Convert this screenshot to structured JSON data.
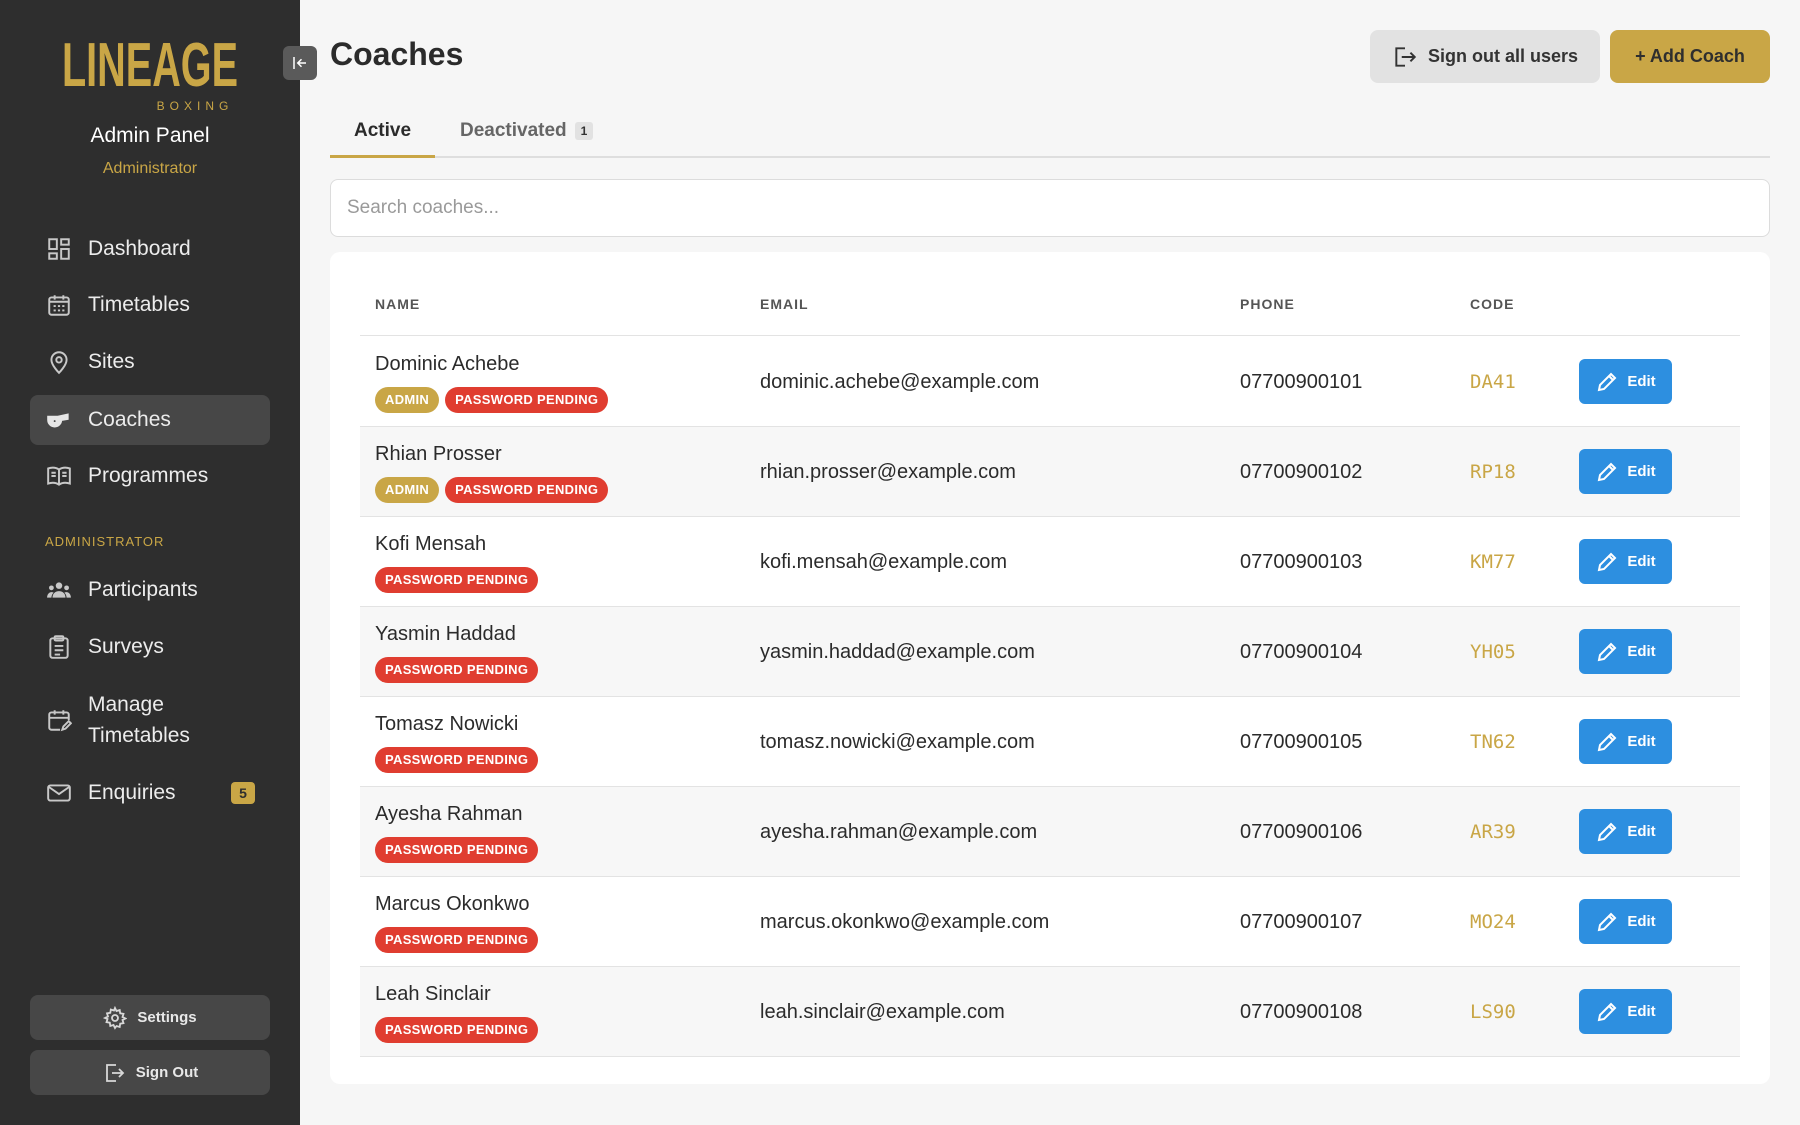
{
  "sidebar": {
    "logo_text": "LINEAGE",
    "logo_subtext": "BOXING",
    "title": "Admin Panel",
    "role": "Administrator",
    "nav": [
      {
        "label": "Dashboard",
        "icon": "dashboard-icon"
      },
      {
        "label": "Timetables",
        "icon": "calendar-icon"
      },
      {
        "label": "Sites",
        "icon": "map-pin-icon"
      },
      {
        "label": "Coaches",
        "icon": "whistle-icon",
        "active": true
      },
      {
        "label": "Programmes",
        "icon": "book-icon"
      }
    ],
    "section_label": "ADMINISTRATOR",
    "admin_nav": [
      {
        "label": "Participants",
        "icon": "people-icon"
      },
      {
        "label": "Surveys",
        "icon": "clipboard-icon"
      },
      {
        "label": "Manage Timetables",
        "icon": "calendar-edit-icon"
      },
      {
        "label": "Enquiries",
        "icon": "mail-icon",
        "badge": "5"
      }
    ],
    "settings_label": "Settings",
    "signout_label": "Sign Out"
  },
  "header": {
    "title": "Coaches",
    "signout_all_label": "Sign out all users",
    "add_label": "+ Add Coach"
  },
  "tabs": {
    "active_label": "Active",
    "deactivated_label": "Deactivated",
    "deactivated_count": "1"
  },
  "search": {
    "placeholder": "Search coaches...",
    "value": ""
  },
  "table": {
    "headers": {
      "name": "NAME",
      "email": "EMAIL",
      "phone": "PHONE",
      "code": "CODE"
    },
    "edit_label": "Edit",
    "rows": [
      {
        "name": "Dominic Achebe",
        "badges": [
          "ADMIN",
          "PASSWORD PENDING"
        ],
        "email": "dominic.achebe@example.com",
        "phone": "07700900101",
        "code": "DA41"
      },
      {
        "name": "Rhian Prosser",
        "badges": [
          "ADMIN",
          "PASSWORD PENDING"
        ],
        "email": "rhian.prosser@example.com",
        "phone": "07700900102",
        "code": "RP18"
      },
      {
        "name": "Kofi Mensah",
        "badges": [
          "PASSWORD PENDING"
        ],
        "email": "kofi.mensah@example.com",
        "phone": "07700900103",
        "code": "KM77"
      },
      {
        "name": "Yasmin Haddad",
        "badges": [
          "PASSWORD PENDING"
        ],
        "email": "yasmin.haddad@example.com",
        "phone": "07700900104",
        "code": "YH05"
      },
      {
        "name": "Tomasz Nowicki",
        "badges": [
          "PASSWORD PENDING"
        ],
        "email": "tomasz.nowicki@example.com",
        "phone": "07700900105",
        "code": "TN62"
      },
      {
        "name": "Ayesha Rahman",
        "badges": [
          "PASSWORD PENDING"
        ],
        "email": "ayesha.rahman@example.com",
        "phone": "07700900106",
        "code": "AR39"
      },
      {
        "name": "Marcus Okonkwo",
        "badges": [
          "PASSWORD PENDING"
        ],
        "email": "marcus.okonkwo@example.com",
        "phone": "07700900107",
        "code": "MO24"
      },
      {
        "name": "Leah Sinclair",
        "badges": [
          "PASSWORD PENDING"
        ],
        "email": "leah.sinclair@example.com",
        "phone": "07700900108",
        "code": "LS90"
      }
    ]
  },
  "colors": {
    "accent": "#c9a646",
    "sidebar": "#2e2e2e",
    "danger": "#e03d30",
    "primary": "#2d8fe0"
  }
}
